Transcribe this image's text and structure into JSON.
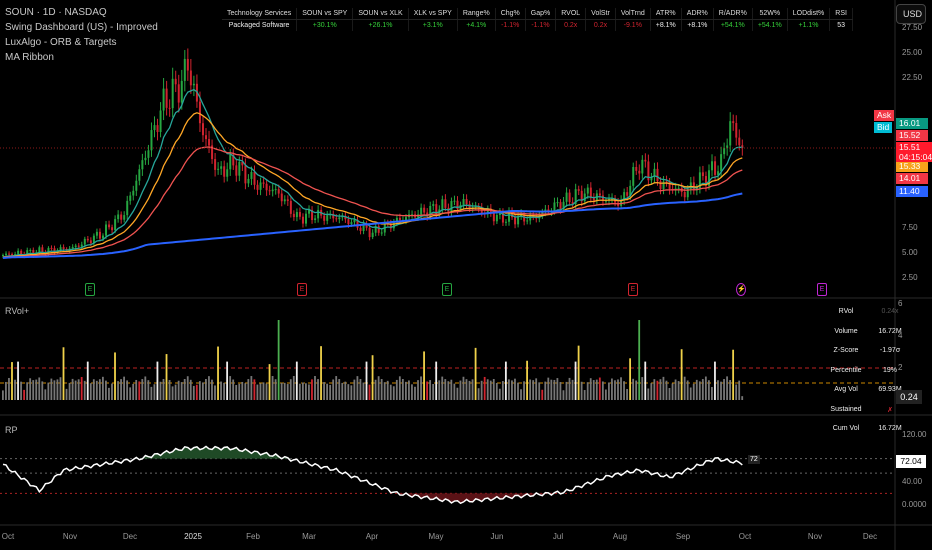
{
  "legend": {
    "symbol": "SOUN · 1D · NASDAQ",
    "indicators": [
      "Swing Dashboard (US) - Improved",
      "LuxAlgo - ORB & Targets",
      "MA Ribbon"
    ]
  },
  "dashboard": {
    "headers": [
      "Technology Services",
      "SOUN vs SPY",
      "SOUN vs XLK",
      "XLK vs SPY",
      "Range%",
      "Chg%",
      "Gap%",
      "RVOL",
      "VolStr",
      "VolTrnd",
      "ATR%",
      "ADR%",
      "R/ADR%",
      "52W%",
      "LODdist%",
      "RSI"
    ],
    "values": [
      "Packaged Software",
      "+30.1%",
      "+26.1%",
      "+3.1%",
      "+4.1%",
      "-1.1%",
      "-1.1%",
      "0.2x",
      "0.2x",
      "-9.1%",
      "+8.1%",
      "+8.1%",
      "+54.1%",
      "+54.1%",
      "+1.1%",
      "53"
    ],
    "value_colors": [
      "w",
      "g",
      "g",
      "g",
      "g",
      "r",
      "r",
      "r",
      "r",
      "r",
      "w",
      "w",
      "g",
      "g",
      "g",
      "w"
    ]
  },
  "currency": "USD",
  "price_axis": [
    "27.50",
    "25.00",
    "22.50",
    "7.50",
    "5.00",
    "2.50"
  ],
  "price_tags": {
    "high": "16.01",
    "ask_label": "Ask",
    "ask": "15.52",
    "bid_label": "Bid",
    "bid": "15.51",
    "last": "15.51",
    "countdown": "04:15:04",
    "ma1": "15.33",
    "ma2": "14.01",
    "ma3": "11.40"
  },
  "colors": {
    "up": "#26a641",
    "down": "#d1242f",
    "ma_fast": "#26a69a",
    "ma_mid": "#ffa726",
    "ma_slow": "#ef5350",
    "ma_long": "#2962ff",
    "accent": "#ff2433"
  },
  "rvol": {
    "title": "RVol+",
    "axis": [
      "6",
      "4",
      "2"
    ],
    "last": "0.24",
    "stats": [
      [
        "RVol",
        "0.24x"
      ],
      [
        "Volume",
        "16.72M"
      ],
      [
        "Z-Score",
        "-1.97σ"
      ],
      [
        "Percentile",
        "19%"
      ],
      [
        "Avg Vol",
        "69.93M"
      ],
      [
        "Sustained",
        "✗"
      ],
      [
        "Cum Vol",
        "16.72M"
      ]
    ]
  },
  "rp": {
    "title": "RP",
    "axis": [
      "120.00",
      "40.00",
      "0.0000"
    ],
    "last": "72.04",
    "label": "72"
  },
  "time_axis": [
    "Oct",
    "Nov",
    "Dec",
    "2025",
    "Feb",
    "Mar",
    "Apr",
    "May",
    "Jun",
    "Jul",
    "Aug",
    "Sep",
    "Oct",
    "Nov",
    "Dec"
  ],
  "events": [
    {
      "label": "E",
      "kind": "earnings-up"
    },
    {
      "label": "E",
      "kind": "earnings-down"
    },
    {
      "label": "E",
      "kind": "earnings-up"
    },
    {
      "label": "E",
      "kind": "earnings-down"
    },
    {
      "label": "⚡",
      "kind": "split"
    },
    {
      "label": "E",
      "kind": "earnings-future"
    }
  ],
  "chart_data": {
    "type": "candlestick",
    "price_keypoints": [
      [
        0,
        4.8
      ],
      [
        23,
        5.5
      ],
      [
        33,
        7
      ],
      [
        40,
        9
      ],
      [
        46,
        14
      ],
      [
        53,
        20
      ],
      [
        59,
        22
      ],
      [
        61,
        24
      ],
      [
        66,
        17
      ],
      [
        71,
        13
      ],
      [
        76,
        14
      ],
      [
        83,
        12
      ],
      [
        91,
        11
      ],
      [
        97,
        8.5
      ],
      [
        102,
        8.8
      ],
      [
        112,
        8.5
      ],
      [
        122,
        7
      ],
      [
        132,
        8.5
      ],
      [
        143,
        9.5
      ],
      [
        152,
        10
      ],
      [
        164,
        8.5
      ],
      [
        175,
        8.5
      ],
      [
        184,
        10
      ],
      [
        191,
        11
      ],
      [
        204,
        10
      ],
      [
        210,
        14
      ],
      [
        217,
        12
      ],
      [
        225,
        11
      ],
      [
        231,
        12.5
      ],
      [
        237,
        14
      ],
      [
        240,
        18
      ],
      [
        244,
        15.5
      ]
    ],
    "rp_keypoints": [
      [
        0,
        70
      ],
      [
        12,
        25
      ],
      [
        20,
        60
      ],
      [
        30,
        68
      ],
      [
        45,
        80
      ],
      [
        60,
        98
      ],
      [
        75,
        98
      ],
      [
        90,
        85
      ],
      [
        110,
        60
      ],
      [
        130,
        20
      ],
      [
        150,
        5
      ],
      [
        170,
        15
      ],
      [
        185,
        22
      ],
      [
        200,
        50
      ],
      [
        210,
        60
      ],
      [
        220,
        48
      ],
      [
        235,
        80
      ],
      [
        244,
        72
      ]
    ]
  }
}
